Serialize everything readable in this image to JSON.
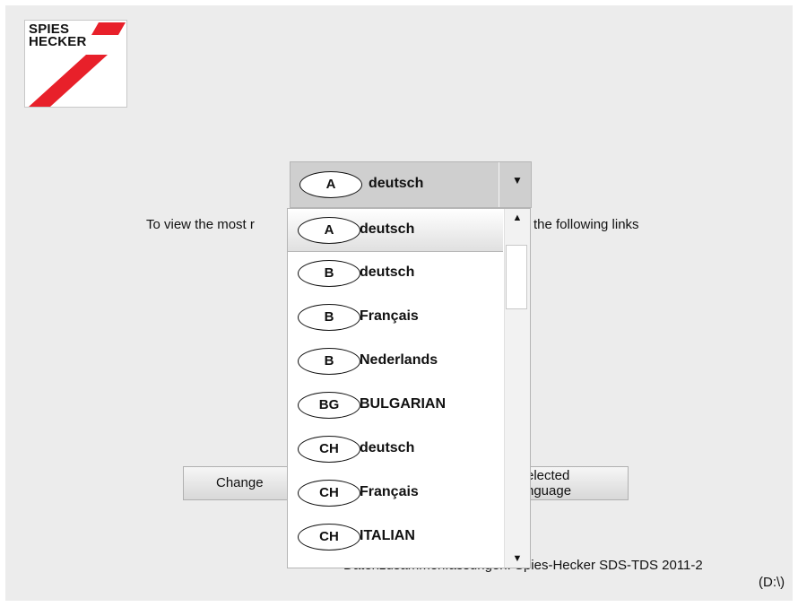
{
  "logo": {
    "line1": "SPIES",
    "line2": "HECKER",
    "stripe_color": "#e8202a"
  },
  "combo": {
    "selected_code": "A",
    "selected_label": "deutsch",
    "arrow_icon": "▼"
  },
  "background": {
    "intro_left": "To view the most r",
    "intro_right": "the following links",
    "button_left_text": "Change",
    "button_right_line1": "elected",
    "button_right_line2": "nguage",
    "footer_line1": "Datenzusammenfassungen: Spies-Hecker SDS-TDS 2011-2",
    "footer_line2": "(D:\\)"
  },
  "dropdown": {
    "options": [
      {
        "code": "A",
        "label": "deutsch"
      },
      {
        "code": "B",
        "label": "deutsch"
      },
      {
        "code": "B",
        "label": "Français"
      },
      {
        "code": "B",
        "label": "Nederlands"
      },
      {
        "code": "BG",
        "label": "BULGARIAN"
      },
      {
        "code": "CH",
        "label": "deutsch"
      },
      {
        "code": "CH",
        "label": "Français"
      },
      {
        "code": "CH",
        "label": "ITALIAN"
      }
    ],
    "up_icon": "▲",
    "down_icon": "▼"
  }
}
